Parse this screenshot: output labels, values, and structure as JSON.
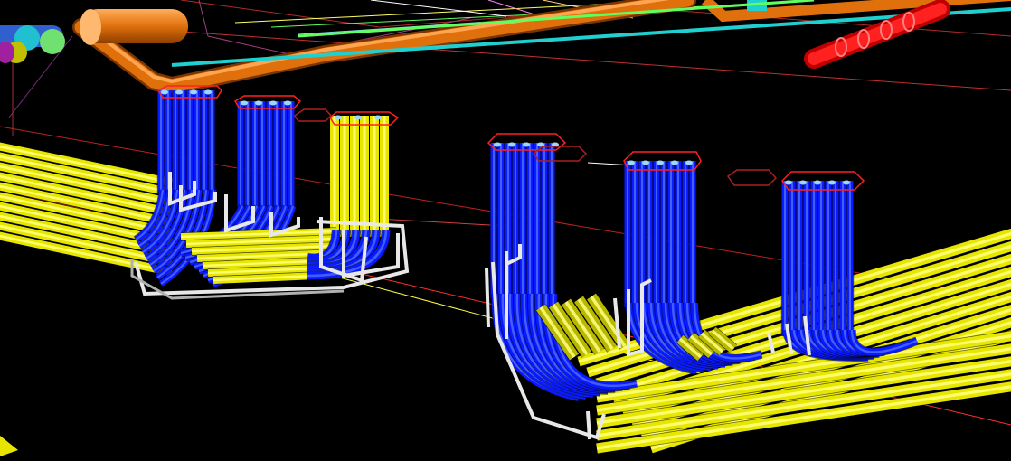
{
  "scene": {
    "background": "#000000",
    "colors": {
      "power_cable": "#0a1aff",
      "power_cable_highlight": "#4d6bff",
      "cable_run": "#e6e600",
      "cable_run_highlight": "#ffff80",
      "support_frame": "#e8e8e8",
      "support_frame_shade": "#9a9a9a",
      "overhead_pipe": "#e0700c",
      "overhead_pipe_highlight": "#ffa04a",
      "red_pipe": "#ff1a1a",
      "cyan_pipe": "#20d0d0",
      "green_pipe": "#6cd96c",
      "outline_red": "#ff2020",
      "guide_line": "#ff3030",
      "guide_line_yellow": "#ffff40"
    },
    "cable_groups": [
      {
        "name": "riser-group-1",
        "color": "power_cable"
      },
      {
        "name": "riser-group-2",
        "color": "power_cable"
      },
      {
        "name": "riser-group-3",
        "color": "cable_run"
      },
      {
        "name": "riser-group-4",
        "color": "power_cable"
      },
      {
        "name": "riser-group-5",
        "color": "power_cable"
      },
      {
        "name": "riser-group-6",
        "color": "power_cable"
      }
    ]
  }
}
